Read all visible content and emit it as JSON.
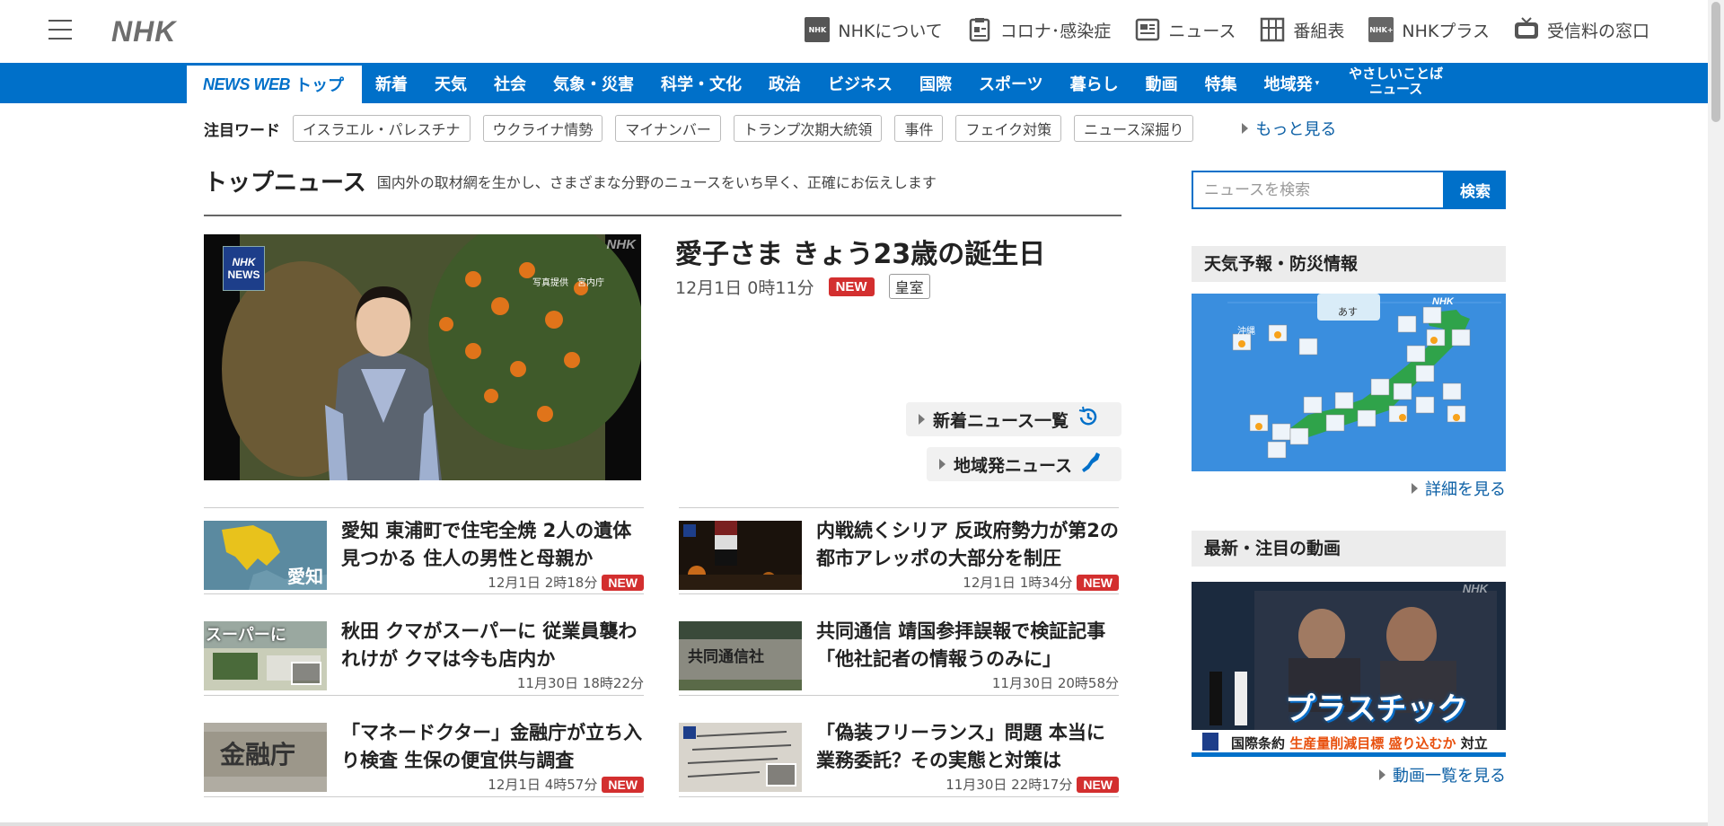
{
  "header": {
    "logo": "NHK",
    "nav": [
      {
        "label": "NHKについて",
        "icon": "nhk-icon"
      },
      {
        "label": "コロナ･感染症",
        "icon": "clipboard-icon"
      },
      {
        "label": "ニュース",
        "icon": "newspaper-icon"
      },
      {
        "label": "番組表",
        "icon": "grid-icon"
      },
      {
        "label": "NHKプラス",
        "icon": "nhk-plus-icon"
      },
      {
        "label": "受信料の窓口",
        "icon": "tv-icon"
      }
    ]
  },
  "bluenav": {
    "top_brand": "NEWS WEB",
    "top_label": "トップ",
    "items": [
      "新着",
      "天気",
      "社会",
      "気象・災害",
      "科学・文化",
      "政治",
      "ビジネス",
      "国際",
      "スポーツ",
      "暮らし",
      "動画",
      "特集",
      "地域発"
    ],
    "yasashii_line1": "やさしいことば",
    "yasashii_line2": "ニュース"
  },
  "keywords": {
    "label": "注目ワード",
    "items": [
      "イスラエル・パレスチナ",
      "ウクライナ情勢",
      "マイナンバー",
      "トランプ次期大統領",
      "事件",
      "フェイク対策",
      "ニュース深掘り"
    ],
    "more": "もっと見る"
  },
  "top_news": {
    "heading": "トップニュース",
    "subheading": "国内外の取材網を生かし、さまざまな分野のニュースをいち早く、正確にお伝えします",
    "hero": {
      "title": "愛子さま きょう23歳の誕生日",
      "time": "12月1日 0時11分",
      "badge": "NEW",
      "tag": "皇室",
      "image_caption": "写真提供　宮内庁",
      "logo_nhk": "NHK",
      "logo_news": "NEWS"
    },
    "links": {
      "latest": "新着ニュース一覧",
      "regional": "地域発ニュース"
    },
    "articles": [
      {
        "title": "愛知 東浦町で住宅全焼 2人の遺体見つかる 住人の男性と母親か",
        "time": "12月1日 2時18分",
        "badge": "NEW",
        "thumb_text": "愛知"
      },
      {
        "title": "内戦続くシリア 反政府勢力が第2の都市アレッポの大部分を制圧",
        "time": "12月1日 1時34分",
        "badge": "NEW",
        "thumb_text": ""
      },
      {
        "title": "秋田 クマがスーパーに 従業員襲われけが クマは今も店内か",
        "time": "11月30日 18時22分",
        "badge": "",
        "thumb_text": "スーパーに"
      },
      {
        "title": "共同通信 靖国参拝誤報で検証記事「他社記者の情報うのみに」",
        "time": "11月30日 20時58分",
        "badge": "",
        "thumb_text": "共同通信社"
      },
      {
        "title": "「マネードクター」金融庁が立ち入り検査 生保の便宜供与調査",
        "time": "12月1日 4時57分",
        "badge": "NEW",
        "thumb_text": "金融庁"
      },
      {
        "title": "「偽装フリーランス」問題 本当に業務委託？その実態と対策は",
        "time": "11月30日 22時17分",
        "badge": "NEW",
        "thumb_text": ""
      }
    ]
  },
  "sidebar": {
    "search_placeholder": "ニュースを検索",
    "search_button": "検索",
    "weather": {
      "heading": "天気予報・防災情報",
      "map_label": "あす",
      "city_label": "沖縄",
      "more": "詳細を見る"
    },
    "video": {
      "heading": "最新・注目の動画",
      "overlay_text": "プラスチック",
      "caption_prefix": "国際条約",
      "caption_highlight": "生産量削減目標 盛り込むか",
      "caption_suffix": "対立",
      "more": "動画一覧を見る"
    }
  },
  "colors": {
    "brand_blue": "#0070c9",
    "new_red": "#d32f2f",
    "link_blue": "#0b5fa5"
  }
}
